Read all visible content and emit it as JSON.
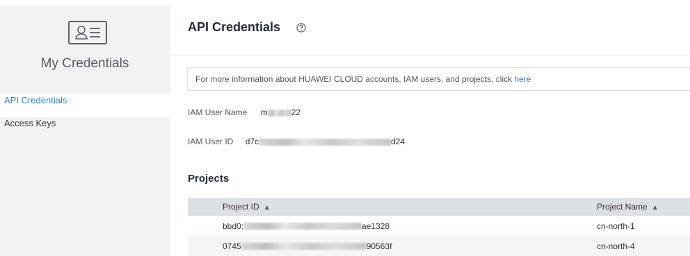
{
  "sidebar": {
    "title": "My Credentials",
    "items": [
      {
        "label": "API Credentials",
        "active": true
      },
      {
        "label": "Access Keys",
        "active": false
      }
    ]
  },
  "main": {
    "title": "API Credentials",
    "info": {
      "text": "For more information about HUAWEI CLOUD accounts, IAM users, and projects, click ",
      "link": "here"
    },
    "iam_user_name": {
      "label": "IAM User Name",
      "value_prefix": "m",
      "value_suffix": "22"
    },
    "iam_user_id": {
      "label": "IAM User ID",
      "value_prefix": "d7c",
      "value_suffix": "d24"
    },
    "projects_title": "Projects",
    "table": {
      "headers": {
        "project_id": "Project ID",
        "project_name": "Project Name"
      },
      "rows": [
        {
          "id_prefix": "bbd0:",
          "id_suffix": "ae1328",
          "name": "cn-north-1"
        },
        {
          "id_prefix": "0745",
          "id_suffix": "90563f",
          "name": "cn-north-4"
        }
      ]
    }
  },
  "colors": {
    "accent": "#2a7de1",
    "sidebar_bg": "#f2f2f2",
    "table_header_bg": "#dcdfe3"
  }
}
